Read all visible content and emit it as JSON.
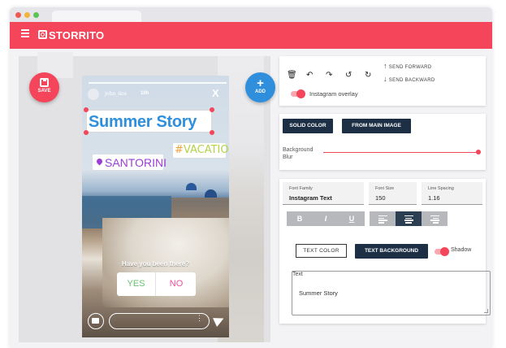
{
  "app": {
    "brand": "STORRITO",
    "accent": "#f4455a",
    "dark_button": "#1c2f45"
  },
  "fabs": {
    "save_label": "SAVE",
    "add_label": "ADD"
  },
  "story": {
    "username": "john_doe",
    "time": "10h",
    "close": "X",
    "title": "Summer Story",
    "hashtag_hash": "#",
    "hashtag_text": "VACATION",
    "location": "SANTORINI",
    "poll_question": "Have you been there?",
    "poll_yes": "YES",
    "poll_no": "NO",
    "msg_dots": "⋮"
  },
  "toolbar": {
    "delete_icon": "🗑",
    "undo_icon": "↶",
    "redo_icon": "↷",
    "rotate_left_icon": "↺",
    "rotate_right_icon": "↻",
    "send_forward": "SEND FORWARD",
    "send_backward": "SEND BACKWARD",
    "arrow_up": "↑",
    "arrow_down": "↓",
    "overlay_label": "Instagram overlay",
    "overlay_on": true
  },
  "background": {
    "solid_color": "SOLID COLOR",
    "from_main_image": "FROM MAIN IMAGE",
    "blur_label_1": "Background",
    "blur_label_2": "Blur",
    "blur_value": 1.0
  },
  "text_panel": {
    "font_family_label": "Font Family",
    "font_family_value": "Instagram Text",
    "font_size_label": "Font Size",
    "font_size_value": "150",
    "line_spacing_label": "Line Spacing",
    "line_spacing_value": "1.16",
    "bold": "B",
    "italic": "I",
    "underline": "U",
    "text_color": "TEXT COLOR",
    "text_background": "TEXT BACKGROUND",
    "shadow_label": "Shadow",
    "shadow_on": true,
    "text_label": "Text",
    "text_value": "Summer Story"
  }
}
